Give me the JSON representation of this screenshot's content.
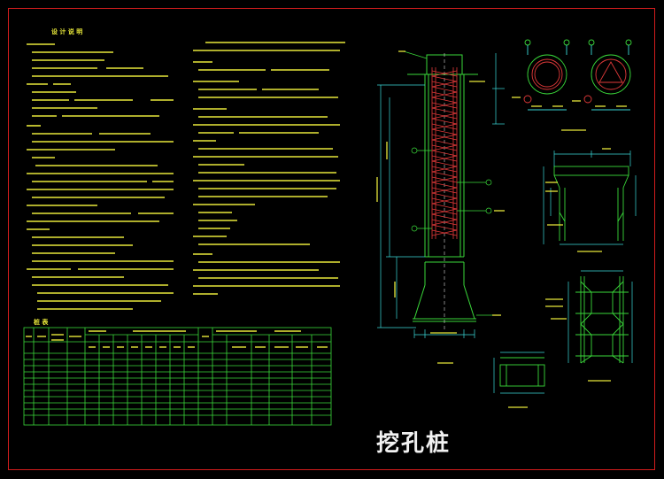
{
  "drawing": {
    "title": "挖孔桩",
    "notes_heading": "设 计 说 明",
    "table_heading": "桩 表"
  },
  "colors": {
    "background": "#000000",
    "frame": "#d21d1d",
    "text": "#e8e83a",
    "outline": "#3ad93a",
    "rebar": "#e23a3a",
    "dimension": "#3ad9d9",
    "title": "#f2f2f2"
  }
}
